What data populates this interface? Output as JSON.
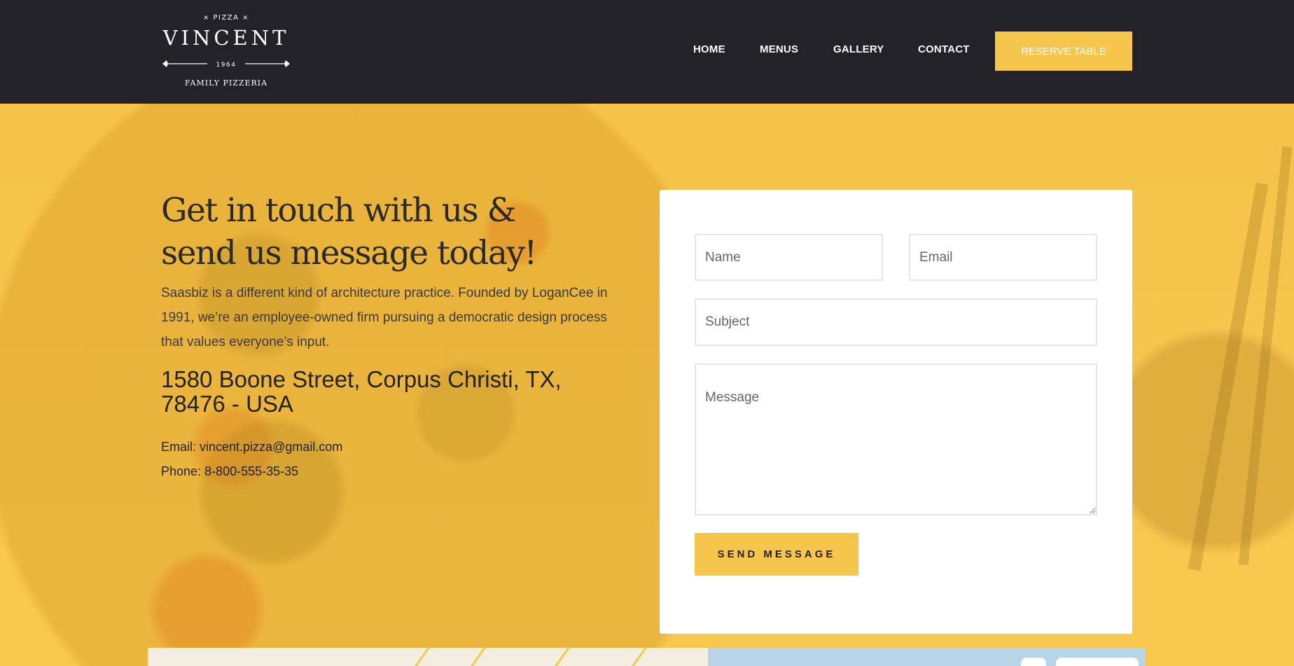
{
  "header": {
    "logo": {
      "top": "× PIZZA ×",
      "name": "VINCENT",
      "year": "1964",
      "tagline": "FAMILY PIZZERIA"
    },
    "nav": [
      "HOME",
      "MENUS",
      "GALLERY",
      "CONTACT"
    ],
    "cta": "RESERVE TABLE"
  },
  "hero": {
    "heading_line1": "Get in touch with us &",
    "heading_line2": "send us message today!",
    "description": "Saasbiz is a different kind of architecture practice. Founded by LoganCee in 1991, we’re an employee-owned firm pursuing a democratic design process that values everyone’s input.",
    "address": "1580 Boone Street, Corpus Christi, TX, 78476 - USA",
    "email": "Email: vincent.pizza@gmail.com",
    "phone": "Phone: 8-800-555-35-35"
  },
  "form": {
    "name_placeholder": "Name",
    "email_placeholder": "Email",
    "subject_placeholder": "Subject",
    "message_placeholder": "Message",
    "submit": "SEND MESSAGE"
  },
  "colors": {
    "accent": "#f7c54b",
    "header_bg": "#222228"
  }
}
